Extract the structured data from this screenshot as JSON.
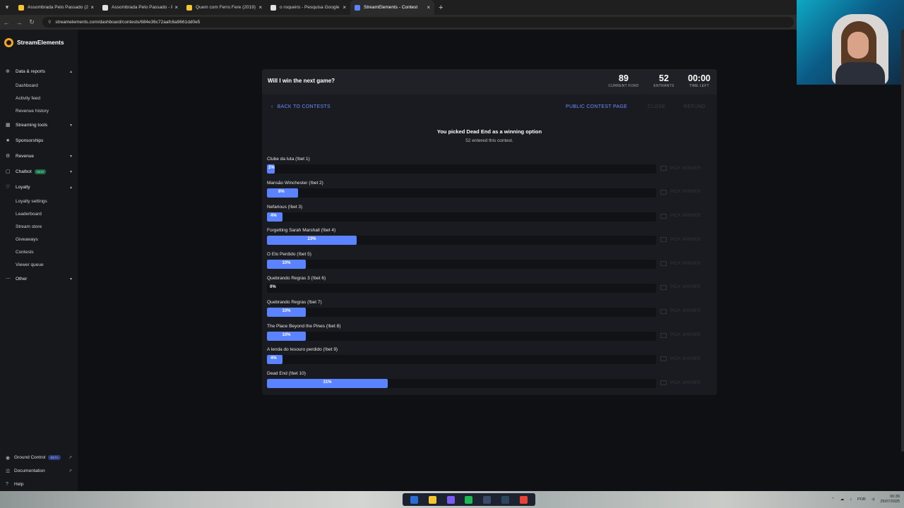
{
  "browser": {
    "tabs": [
      {
        "label": "Assombrada Pelo Passado (2019",
        "color": "#f2c531"
      },
      {
        "label": "Assombrada Pelo Passado - Pe",
        "color": "#e0e0e0"
      },
      {
        "label": "Quem com Ferro Fere (2019) -",
        "color": "#f2c531"
      },
      {
        "label": "o roqueiro - Pesquisa Google",
        "color": "#e0e0e0"
      },
      {
        "label": "StreamElements - Contest",
        "color": "#5b82ff"
      }
    ],
    "url": "streamelements.com/dashboard/contests/684e36c72aafc6a9661dd0e5"
  },
  "sidebar": {
    "brand": "StreamElements",
    "sections": [
      {
        "label": "Data & reports",
        "icon": "chart-icon",
        "glyph": "⊕",
        "chev": "▴"
      },
      {
        "label": "Streaming tools",
        "icon": "tools-icon",
        "glyph": "▦",
        "chev": "▾"
      },
      {
        "label": "Sponsorships",
        "icon": "star-icon",
        "glyph": "★",
        "chev": ""
      },
      {
        "label": "Revenue",
        "icon": "gear-icon",
        "glyph": "⚙",
        "chev": "▾"
      },
      {
        "label": "Chatbot",
        "icon": "chat-icon",
        "glyph": "▢",
        "chev": "▾",
        "badge": "NEW"
      },
      {
        "label": "Loyalty",
        "icon": "heart-icon",
        "glyph": "♡",
        "chev": "▴"
      },
      {
        "label": "Other",
        "icon": "dots-icon",
        "glyph": "⋯",
        "chev": "▾"
      }
    ],
    "data_reports_items": [
      "Dashboard",
      "Activity feed",
      "Revenue history"
    ],
    "loyalty_items": [
      "Loyalty settings",
      "Leaderboard",
      "Stream store",
      "Giveaways",
      "Contests",
      "Viewer queue"
    ],
    "bottom": [
      {
        "label": "Ground Control",
        "badge": "BETA",
        "icon": "satellite-icon",
        "glyph": "◉"
      },
      {
        "label": "Documentation",
        "icon": "book-icon",
        "glyph": "☰"
      },
      {
        "label": "Help",
        "icon": "help-icon",
        "glyph": "?"
      }
    ]
  },
  "contest": {
    "title": "Will I win the next game?",
    "current_fund": "89",
    "current_fund_label": "CURRENT FUND",
    "entrants": "52",
    "entrants_label": "ENTRANTS",
    "time_left": "00:00",
    "time_left_label": "TIME LEFT",
    "back_label": "BACK TO CONTESTS",
    "public_label": "PUBLIC CONTEST PAGE",
    "close_label": "CLOSE",
    "refund_label": "REFUND",
    "winner_text": "You picked Dead End as a winning option",
    "entered_text": "52 entered this contest.",
    "pick_label": "PICK WINNER",
    "options": [
      {
        "label": "Clube da luta (!bet 1)",
        "percent": 2,
        "text": "2%"
      },
      {
        "label": "Mansão Winchester (!bet 2)",
        "percent": 8,
        "text": "8%"
      },
      {
        "label": "Nefarious (!bet 3)",
        "percent": 4,
        "text": "4%"
      },
      {
        "label": "Forgetting Sarah Marshall (!bet 4)",
        "percent": 23,
        "text": "23%"
      },
      {
        "label": "O Elo Perdido (!bet 5)",
        "percent": 10,
        "text": "10%"
      },
      {
        "label": "Quebrando Regras 3 (!bet 6)",
        "percent": 0,
        "text": "0%"
      },
      {
        "label": "Quebrando Regras (!bet 7)",
        "percent": 10,
        "text": "10%"
      },
      {
        "label": "The Place Beyond the Pines (!bet 8)",
        "percent": 10,
        "text": "10%"
      },
      {
        "label": "A lenda do tesouro perdido (!bet 9)",
        "percent": 4,
        "text": "4%"
      },
      {
        "label": "Dead End (!bet 10)",
        "percent": 31,
        "text": "31%"
      }
    ]
  },
  "taskbar": {
    "lang": "POR",
    "time": "00:30",
    "date": "25/07/2025",
    "apps": [
      "#2b6cd4",
      "#f2c531",
      "#7a5cf0",
      "#1db954",
      "#3b4a66",
      "#2a475e",
      "#e94235"
    ]
  }
}
